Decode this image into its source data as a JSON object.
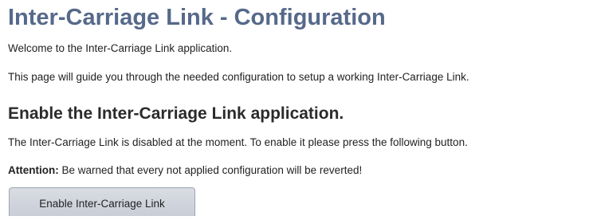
{
  "page": {
    "title": "Inter-Carriage Link - Configuration",
    "intro_welcome": "Welcome to the Inter-Carriage Link application.",
    "intro_guide": "This page will guide you through the needed configuration to setup a working Inter-Carriage Link."
  },
  "enable_section": {
    "heading": "Enable the Inter-Carriage Link application.",
    "status_text": "The Inter-Carriage Link is disabled at the moment. To enable it please press the following button.",
    "attention_label": "Attention:",
    "attention_text": " Be warned that every not applied configuration will be reverted!",
    "enable_button_label": "Enable Inter-Carriage Link"
  },
  "colors": {
    "title": "#56698a",
    "heading": "#2b2b2b",
    "text": "#222222",
    "button_bg": "#cfd3db",
    "button_border": "#9ea4b0"
  }
}
